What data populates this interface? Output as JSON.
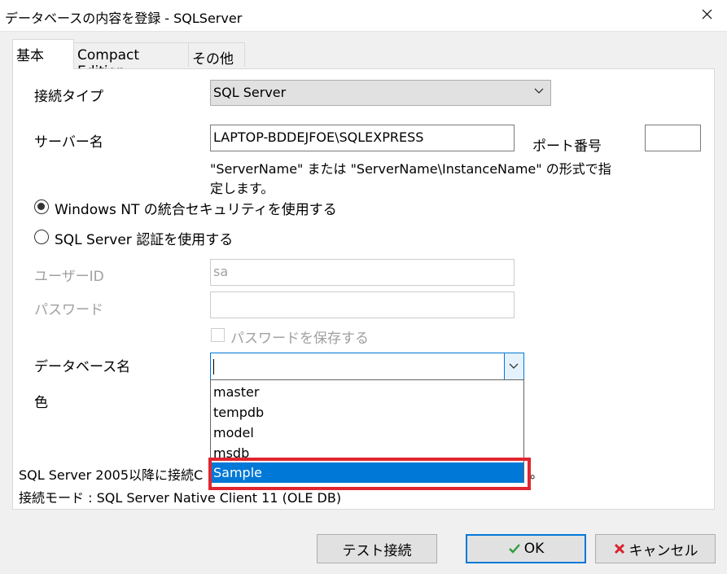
{
  "window": {
    "title": "データベースの内容を登録 - SQLServer"
  },
  "tabs": [
    {
      "label": "基本",
      "active": true
    },
    {
      "label": "Compact Edition",
      "active": false
    },
    {
      "label": "その他",
      "active": false
    }
  ],
  "form": {
    "connection_type_label": "接続タイプ",
    "connection_type_value": "SQL Server",
    "server_name_label": "サーバー名",
    "server_name_value": "LAPTOP-BDDEJFOE\\SQLEXPRESS",
    "port_label": "ポート番号",
    "port_value": "",
    "server_hint_line1": "\"ServerName\" または \"ServerName\\InstanceName\" の形式で指",
    "server_hint_line2": "定します。",
    "auth_windows_label": "Windows NT の統合セキュリティを使用する",
    "auth_sql_label": "SQL Server 認証を使用する",
    "user_id_label": "ユーザーID",
    "user_id_value": "sa",
    "password_label": "パスワード",
    "password_value": "",
    "save_password_label": "パスワードを保存する",
    "database_label": "データベース名",
    "database_value": "",
    "database_options": [
      "master",
      "tempdb",
      "model",
      "msdb",
      "Sample"
    ],
    "database_selected": "Sample",
    "color_label": "色"
  },
  "info": {
    "line1": "SQL Server 2005以降に接続C",
    "line1_tail": "。",
    "line2": "接続モード : SQL Server Native Client 11 (OLE DB)"
  },
  "buttons": {
    "test_label": "テスト接続",
    "ok_label": "OK",
    "cancel_label": "キャンセル"
  },
  "colors": {
    "accent": "#0078d7",
    "highlight": "#e0262f",
    "ok_check": "#2e9e3e",
    "cancel_x": "#d9232e"
  }
}
